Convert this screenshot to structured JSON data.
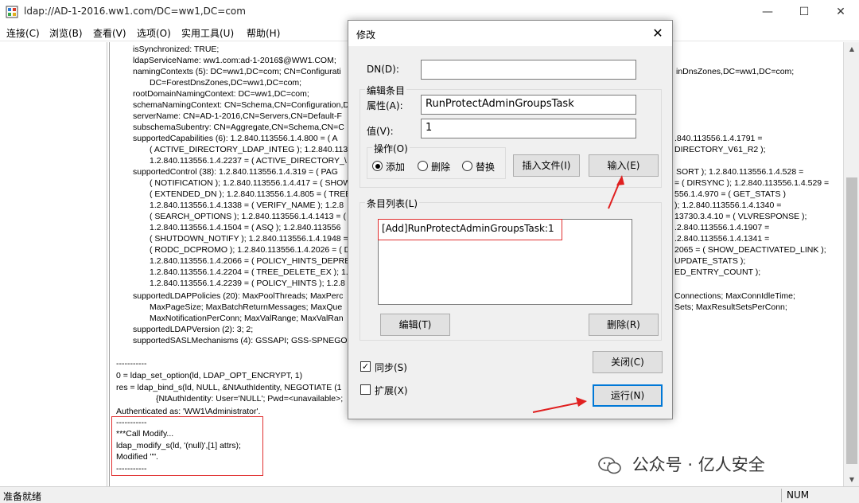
{
  "window": {
    "title": "ldap://AD-1-2016.ww1.com/DC=ww1,DC=com",
    "minimize": "—",
    "maximize": "☐",
    "close": "✕"
  },
  "menu": [
    "连接(C)",
    "浏览(B)",
    "查看(V)",
    "选项(O)",
    "实用工具(U)",
    "帮助(H)"
  ],
  "output_lines": [
    "isSynchronized: TRUE;",
    "ldapServiceName: ww1.com:ad-1-2016$@WW1.COM;",
    "namingContexts (5): DC=ww1,DC=com; CN=Configurati",
    "DC=ForestDnsZones,DC=ww1,DC=com;",
    "rootDomainNamingContext: DC=ww1,DC=com;",
    "schemaNamingContext: CN=Schema,CN=Configuration,D",
    "serverName: CN=AD-1-2016,CN=Servers,CN=Default-F",
    "subschemaSubentry: CN=Aggregate,CN=Schema,CN=C",
    "supportedCapabilities (6): 1.2.840.113556.1.4.800 = ( A",
    "( ACTIVE_DIRECTORY_LDAP_INTEG ); 1.2.840.1135",
    "1.2.840.113556.1.4.2237 = ( ACTIVE_DIRECTORY_\\",
    "supportedControl (38): 1.2.840.113556.1.4.319 = ( PAG",
    "( NOTIFICATION ); 1.2.840.113556.1.4.417 = ( SHOW",
    "( EXTENDED_DN ); 1.2.840.113556.1.4.805 = ( TREE",
    "1.2.840.113556.1.4.1338 = ( VERIFY_NAME ); 1.2.8",
    "( SEARCH_OPTIONS ); 1.2.840.113556.1.4.1413 = (",
    "1.2.840.113556.1.4.1504 = ( ASQ ); 1.2.840.113556",
    "( SHUTDOWN_NOTIFY ); 1.2.840.113556.1.4.1948 =",
    "( RODC_DCPROMO ); 1.2.840.113556.1.4.2026 = ( D",
    "1.2.840.113556.1.4.2066 = ( POLICY_HINTS_DEPRE",
    "1.2.840.113556.1.4.2204 = ( TREE_DELETE_EX ); 1.",
    "1.2.840.113556.1.4.2239 = ( POLICY_HINTS ); 1.2.8",
    "supportedLDAPPolicies (20): MaxPoolThreads; MaxPerc",
    "MaxPageSize; MaxBatchReturnMessages; MaxQue",
    "MaxNotificationPerConn; MaxValRange; MaxValRan",
    "supportedLDAPVersion (2): 3; 2;",
    "supportedSASLMechanisms (4): GSSAPI; GSS-SPNEGO",
    "-----------",
    "0 = ldap_set_option(ld, LDAP_OPT_ENCRYPT, 1)",
    "res = ldap_bind_s(ld, NULL, &NtAuthIdentity, NEGOTIATE (1",
    "{NtAuthIdentity: User='NULL'; Pwd=<unavailable>;",
    "Authenticated as: 'WW1\\Administrator'.",
    "-----------",
    "***Call Modify...",
    "ldap_modify_s(ld, '(null)',[1] attrs);",
    "Modified \"\".",
    "-----------"
  ],
  "output_right": [
    "inDnsZones,DC=ww1,DC=com;",
    ".840.113556.1.4.1791 =",
    "DIRECTORY_V61_R2 );",
    "SORT ); 1.2.840.113556.1.4.528 =",
    "= ( DIRSYNC ); 1.2.840.113556.1.4.529 =",
    "556.1.4.970 = ( GET_STATS )",
    "); 1.2.840.113556.1.4.1340 =",
    "13730.3.4.10 = ( VLVRESPONSE );",
    ".2.840.113556.1.4.1907 =",
    ".2.840.113556.1.4.1341 =",
    "2065 = ( SHOW_DEACTIVATED_LINK );",
    "UPDATE_STATS );",
    "ED_ENTRY_COUNT );",
    "Connections; MaxConnIdleTime;",
    "Sets; MaxResultSetsPerConn;"
  ],
  "status": {
    "text": "准备就绪",
    "num": "NUM"
  },
  "dialog": {
    "title": "修改",
    "close": "✕",
    "dn_label": "DN(D):",
    "dn_value": "",
    "edit_group": "编辑条目",
    "attr_label": "属性(A):",
    "attr_value": "RunProtectAdminGroupsTask",
    "value_label": "值(V):",
    "value_value": "1",
    "op_group": "操作(O)",
    "radio_add": "添加",
    "radio_delete": "删除",
    "radio_replace": "替换",
    "insert_file": "插入文件(I)",
    "enter": "输入(E)",
    "list_group": "条目列表(L)",
    "list_items": [
      "[Add]RunProtectAdminGroupsTask:1"
    ],
    "edit_btn": "编辑(T)",
    "delete_btn": "删除(R)",
    "sync": "同步(S)",
    "extended": "扩展(X)",
    "close_btn": "关闭(C)",
    "run_btn": "运行(N)"
  },
  "watermark": "公众号 · 亿人安全",
  "colors": {
    "annotation": "#e03030",
    "focus": "#0078d7"
  }
}
